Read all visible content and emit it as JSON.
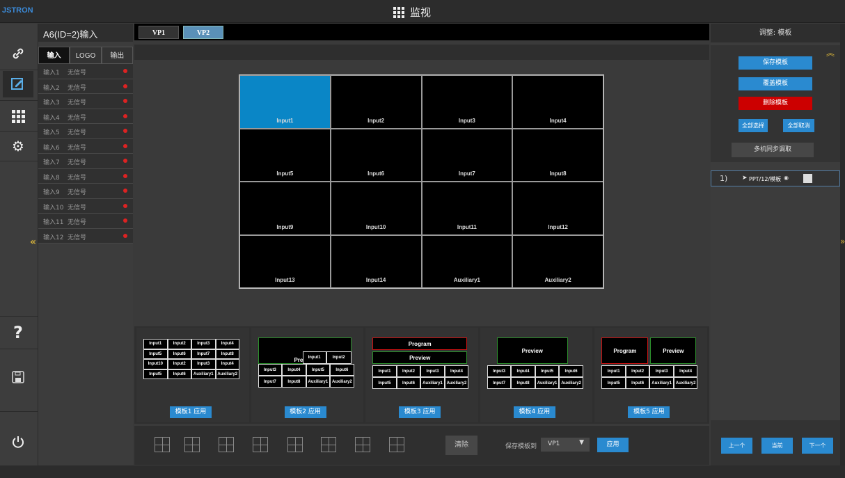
{
  "app": {
    "brand": "JSTRON",
    "title": "监视",
    "title_icon": "grid-icon"
  },
  "sidebar": {
    "items": [
      {
        "name": "link-icon",
        "glyph": "🔗"
      },
      {
        "name": "edit-icon",
        "glyph": "✎"
      },
      {
        "name": "grid-icon",
        "glyph": "▦"
      },
      {
        "name": "gear-icon",
        "glyph": "⚙"
      },
      {
        "name": "help-icon",
        "glyph": "?"
      },
      {
        "name": "save-icon",
        "glyph": "🖫"
      },
      {
        "name": "power-icon",
        "glyph": "⏻"
      }
    ]
  },
  "input_panel": {
    "title": "A6(ID=2)输入",
    "tabs": [
      "输入",
      "LOGO",
      "输出"
    ],
    "rows": [
      {
        "name": "输入1",
        "status": "无信号"
      },
      {
        "name": "输入2",
        "status": "无信号"
      },
      {
        "name": "输入3",
        "status": "无信号"
      },
      {
        "name": "输入4",
        "status": "无信号"
      },
      {
        "name": "输入5",
        "status": "无信号"
      },
      {
        "name": "输入6",
        "status": "无信号"
      },
      {
        "name": "输入7",
        "status": "无信号"
      },
      {
        "name": "输入8",
        "status": "无信号"
      },
      {
        "name": "输入9",
        "status": "无信号"
      },
      {
        "name": "输入10",
        "status": "无信号"
      },
      {
        "name": "输入11",
        "status": "无信号"
      },
      {
        "name": "输入12",
        "status": "无信号"
      }
    ]
  },
  "viewport_tabs": [
    "VP1",
    "VP2"
  ],
  "wall": {
    "cells": [
      "Input1",
      "Input2",
      "Input3",
      "Input4",
      "Input5",
      "Input6",
      "Input7",
      "Input8",
      "Input9",
      "Input10",
      "Input11",
      "Input12",
      "Input13",
      "Input14",
      "Auxiliary1",
      "Auxiliary2"
    ],
    "selected": "Input1"
  },
  "templates": [
    {
      "apply": "模板1 应用"
    },
    {
      "apply": "模板2 应用"
    },
    {
      "apply": "模板3 应用"
    },
    {
      "apply": "模板4 应用"
    },
    {
      "apply": "模板5 应用"
    }
  ],
  "mini_labels": {
    "program": "Program",
    "preview": "Preview",
    "t1": [
      "Input1",
      "Input2",
      "Input3",
      "Input4",
      "Input5",
      "Input6",
      "Input7",
      "Input8",
      "Input10",
      "Input2",
      "Input3",
      "Input4",
      "Input5",
      "Input6",
      "Auxiliary1",
      "Auxiliary2"
    ],
    "t2top": [
      "Input1",
      "Input2"
    ],
    "t2": [
      "Input3",
      "Input4",
      "Input5",
      "Input6",
      "Input7",
      "Input8",
      "Auxiliary1",
      "Auxiliary2"
    ],
    "t3": [
      "Input1",
      "Input2",
      "Input3",
      "Input4",
      "Input5",
      "Input6",
      "Auxiliary1",
      "Auxiliary2"
    ],
    "t4": [
      "Input3",
      "Input4",
      "Input5",
      "Input6",
      "Input7",
      "Input8",
      "Auxiliary1",
      "Auxiliary2"
    ],
    "t5": [
      "Input1",
      "Input2",
      "Input3",
      "Input4",
      "Input5",
      "Input6",
      "Auxiliary1",
      "Auxiliary2"
    ]
  },
  "bottom": {
    "clear": "清除",
    "save_to": "保存模板到",
    "vp_select": "VP1",
    "apply": "应用"
  },
  "right_panel": {
    "title": "调整: 模板",
    "save": "保存模板",
    "overwrite": "覆盖模板",
    "delete": "删除模板",
    "select_all": "全部选择",
    "deselect_all": "全部取消",
    "sync": "多机同步调取",
    "item_index": "1)",
    "item_label": "PPT/12/模板",
    "prev": "上一个",
    "current": "当前",
    "next": "下一个"
  },
  "colors": {
    "accent": "#2a8ad0",
    "danger": "#c00",
    "selected_cell": "#0a86c6"
  }
}
